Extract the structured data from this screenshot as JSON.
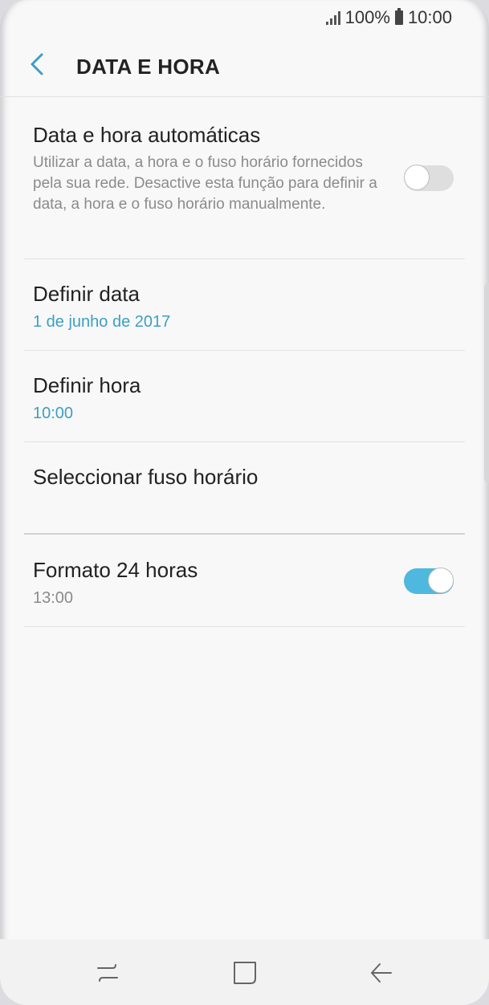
{
  "status_bar": {
    "battery": "100%",
    "time": "10:00"
  },
  "header": {
    "title": "DATA E HORA"
  },
  "settings": {
    "auto_datetime": {
      "title": "Data e hora automáticas",
      "description": "Utilizar a data, a hora e o fuso horário fornecidos pela sua rede. Desactive esta função para definir a data, a hora e o fuso horário manualmente.",
      "enabled": false
    },
    "set_date": {
      "title": "Definir data",
      "value": "1 de junho de 2017"
    },
    "set_time": {
      "title": "Definir hora",
      "value": "10:00"
    },
    "timezone": {
      "title": "Seleccionar fuso horário"
    },
    "format_24h": {
      "title": "Formato 24 horas",
      "example": "13:00",
      "enabled": true
    }
  },
  "colors": {
    "accent": "#3d9fc2",
    "toggle_on": "#4fb8de",
    "background": "#f8f8f8"
  }
}
